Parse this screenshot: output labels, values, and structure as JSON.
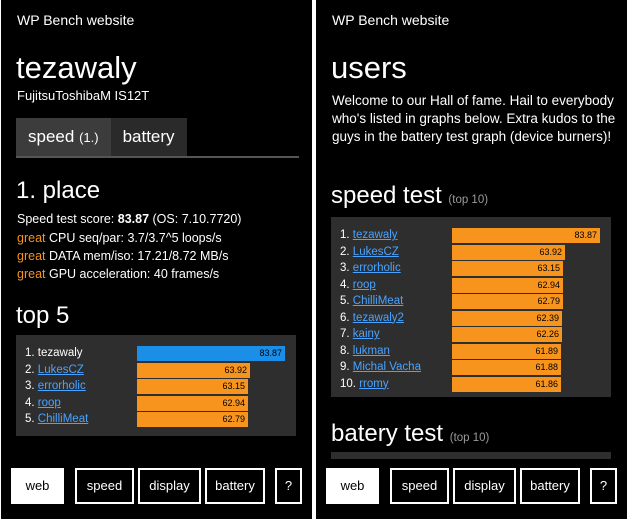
{
  "app_title": "WP Bench website",
  "left": {
    "title": "tezawaly",
    "device": "FujitsuToshibaM IS12T",
    "pivot": [
      {
        "label": "speed",
        "count": "(1.)",
        "active": true
      },
      {
        "label": "battery",
        "count": "",
        "active": false
      }
    ],
    "place_heading": "1. place",
    "score_line": {
      "prefix": "Speed test score: ",
      "score": "83.87",
      "suffix": " (OS: 7.10.7720)"
    },
    "stats": [
      {
        "grade": "great",
        "text": " CPU seq/par: 3.7/3.7^5 loops/s"
      },
      {
        "grade": "great",
        "text": " DATA mem/iso: 17.21/8.72 MB/s"
      },
      {
        "grade": "great",
        "text": " GPU acceleration: 40 frames/s"
      }
    ],
    "top_heading": "top 5",
    "top5": [
      {
        "rank": "1.",
        "name": "tezawaly",
        "value": "83.87",
        "fraction": 1.0,
        "link": false,
        "me": true
      },
      {
        "rank": "2.",
        "name": "LukesCZ",
        "value": "63.92",
        "fraction": 0.762,
        "link": true,
        "me": false
      },
      {
        "rank": "3.",
        "name": "errorholic",
        "value": "63.15",
        "fraction": 0.753,
        "link": true,
        "me": false
      },
      {
        "rank": "4.",
        "name": "roop",
        "value": "62.94",
        "fraction": 0.75,
        "link": true,
        "me": false
      },
      {
        "rank": "5.",
        "name": "ChilliMeat",
        "value": "62.79",
        "fraction": 0.749,
        "link": true,
        "me": false
      }
    ]
  },
  "right": {
    "title": "users",
    "intro": "Welcome to our Hall of fame. Hail to everybody who's listed in graphs below. Extra kudos to the guys in the battery test graph (device burners)!",
    "speed_heading": "speed test",
    "speed_sub": "(top 10)",
    "speed_top10": [
      {
        "rank": "1.",
        "name": "tezawaly",
        "value": "83.87",
        "fraction": 1.0
      },
      {
        "rank": "2.",
        "name": "LukesCZ",
        "value": "63.92",
        "fraction": 0.762
      },
      {
        "rank": "3.",
        "name": "errorholic",
        "value": "63.15",
        "fraction": 0.753
      },
      {
        "rank": "4.",
        "name": "roop",
        "value": "62.94",
        "fraction": 0.75
      },
      {
        "rank": "5.",
        "name": "ChilliMeat",
        "value": "62.79",
        "fraction": 0.749
      },
      {
        "rank": "6.",
        "name": "tezawaly2",
        "value": "62.39",
        "fraction": 0.744
      },
      {
        "rank": "7.",
        "name": "kainy",
        "value": "62.26",
        "fraction": 0.742
      },
      {
        "rank": "8.",
        "name": "lukman",
        "value": "61.89",
        "fraction": 0.738
      },
      {
        "rank": "9.",
        "name": "Michal Vacha",
        "value": "61.88",
        "fraction": 0.738
      },
      {
        "rank": "10.",
        "name": "rromy",
        "value": "61.86",
        "fraction": 0.738
      }
    ],
    "battery_heading": "batery test",
    "battery_sub": "(top 10)"
  },
  "appbar": [
    {
      "label": "web",
      "active": true
    },
    {
      "label": "speed",
      "active": false
    },
    {
      "label": "display",
      "active": false
    },
    {
      "label": "battery",
      "active": false
    },
    {
      "label": "?",
      "active": false
    }
  ],
  "colors": {
    "accent_orange": "#f7941d",
    "accent_blue": "#1b8fe8",
    "link_blue": "#4aa3ff"
  }
}
